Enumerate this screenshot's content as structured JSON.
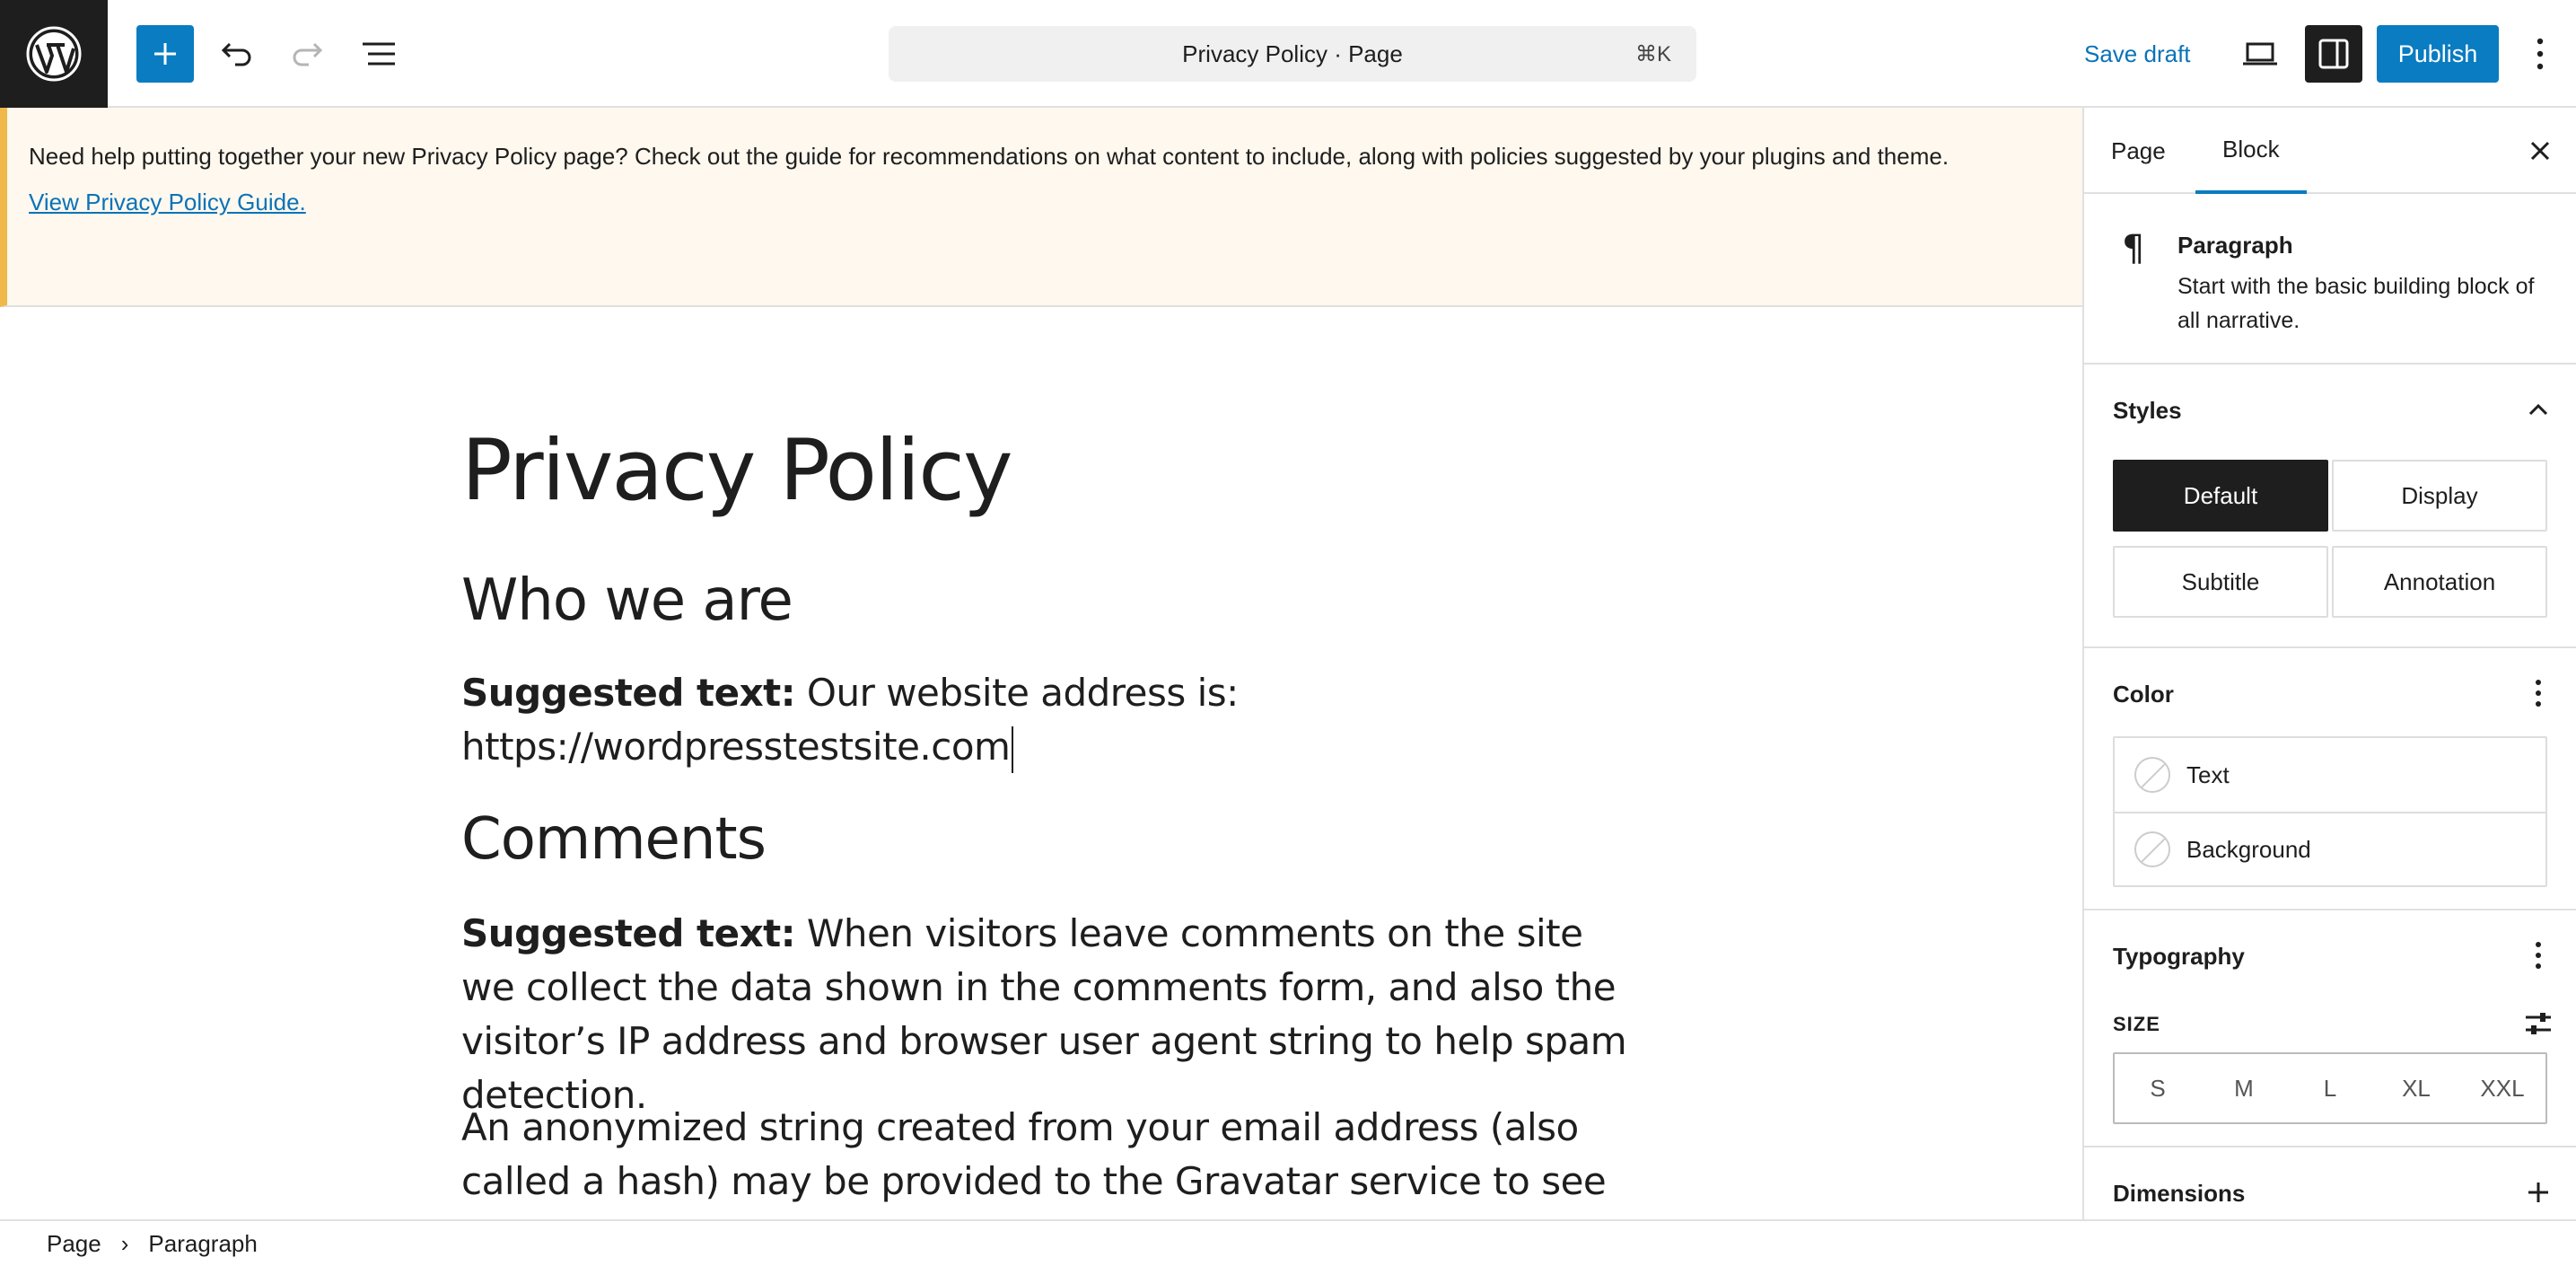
{
  "toolbar": {
    "document_title": "Privacy Policy · Page",
    "shortcut": "⌘K",
    "save_draft": "Save draft",
    "publish": "Publish"
  },
  "notice": {
    "text": "Need help putting together your new Privacy Policy page? Check out the guide for recommendations on what content to include, along with policies suggested by your plugins and theme.",
    "link": "View Privacy Policy Guide."
  },
  "editor": {
    "title": "Privacy Policy",
    "heading_1": "Who we are",
    "para_1_label": "Suggested text:",
    "para_1_text": " Our website address is: https://wordpresstestsite.com",
    "heading_2": "Comments",
    "para_2_label": "Suggested text:",
    "para_2_text": " When visitors leave comments on the site we collect the data shown in the comments form, and also the visitor’s IP address and browser user agent string to help spam detection.",
    "para_3_text": "An anonymized string created from your email address (also called a hash) may be provided to the Gravatar service to see if you are"
  },
  "sidebar": {
    "tabs": [
      {
        "label": "Page"
      },
      {
        "label": "Block"
      }
    ],
    "active_tab": "Block",
    "block": {
      "name": "Paragraph",
      "description": "Start with the basic building block of all narrative."
    },
    "styles": {
      "title": "Styles",
      "options": [
        "Default",
        "Display",
        "Subtitle",
        "Annotation"
      ],
      "selected": "Default"
    },
    "color": {
      "title": "Color",
      "items": [
        "Text",
        "Background"
      ]
    },
    "typography": {
      "title": "Typography",
      "size_label": "SIZE",
      "sizes": [
        "S",
        "M",
        "L",
        "XL",
        "XXL"
      ]
    },
    "dimensions": {
      "title": "Dimensions"
    }
  },
  "breadcrumb": [
    "Page",
    "Paragraph"
  ],
  "colors": {
    "accent": "#0a7cc1",
    "dark": "#1e1e1e",
    "notice_bg": "#fef8ee",
    "notice_border": "#f0b849"
  }
}
